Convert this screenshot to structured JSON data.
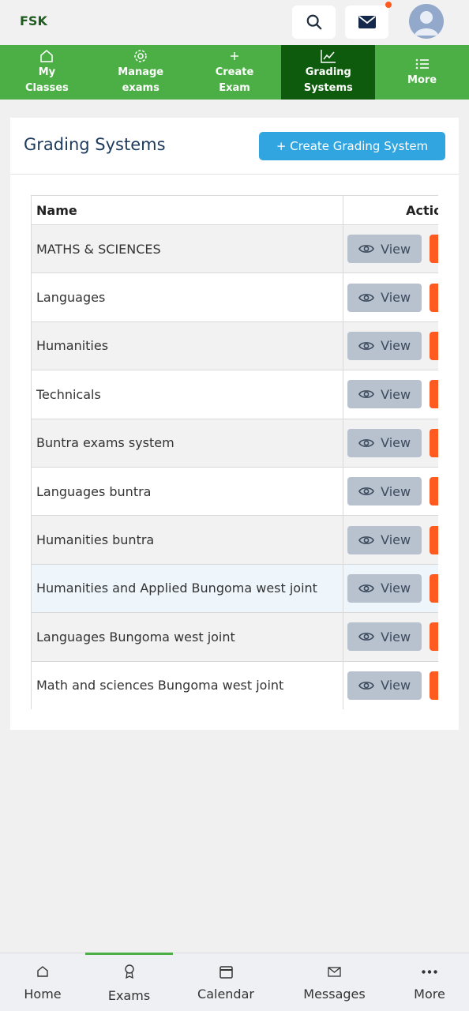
{
  "header": {
    "brand": "FSK"
  },
  "nav": {
    "items": [
      {
        "line1": "My",
        "line2": "Classes",
        "icon": "home-outline-icon"
      },
      {
        "line1": "Manage",
        "line2": "exams",
        "icon": "gear-icon"
      },
      {
        "line1": "Create",
        "line2": "Exam",
        "icon": "plus-icon"
      },
      {
        "line1": "Grading",
        "line2": "Systems",
        "icon": "chart-line-icon"
      },
      {
        "line1": "More",
        "line2": "",
        "icon": "list-icon"
      }
    ],
    "active_index": 3
  },
  "page": {
    "title": "Grading Systems",
    "create_button": "+ Create Grading System"
  },
  "table": {
    "columns": [
      "Name",
      "Actio"
    ],
    "view_label": "View",
    "rows": [
      "MATHS & SCIENCES",
      "Languages",
      "Humanities",
      "Technicals",
      "Buntra exams system",
      "Languages buntra",
      "Humanities buntra",
      "Humanities and Applied Bungoma west joint",
      "Languages Bungoma west joint",
      "Math and sciences Bungoma west joint"
    ]
  },
  "bottom_nav": {
    "items": [
      "Home",
      "Exams",
      "Calendar",
      "Messages",
      "More"
    ],
    "active_index": 1
  },
  "colors": {
    "nav_green": "#4caf46",
    "nav_active": "#0e5b0e",
    "primary": "#30a5e0",
    "danger": "#ff5a1f"
  }
}
